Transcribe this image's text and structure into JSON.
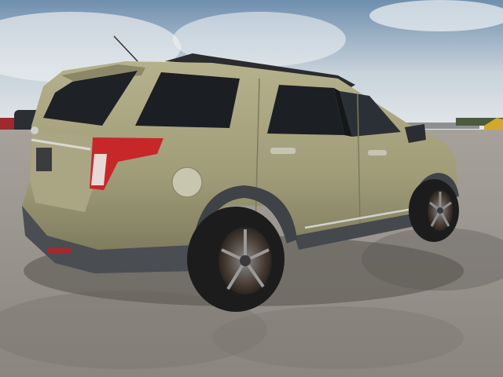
{
  "photo": {
    "subject": "SUV",
    "colors": {
      "sky_top": "#6f8fae",
      "sky_bottom": "#dfe5ea",
      "ground": "#8e8a84",
      "ground_dark": "#6e6a65",
      "body_paint": "#a39f7a",
      "body_shadow": "#7d7a5c",
      "glass": "#1e2226",
      "bumper": "#4a4d52",
      "tire": "#1c1c1c",
      "wheel": "#5a4a40",
      "tail_light": "#c8272a"
    }
  }
}
